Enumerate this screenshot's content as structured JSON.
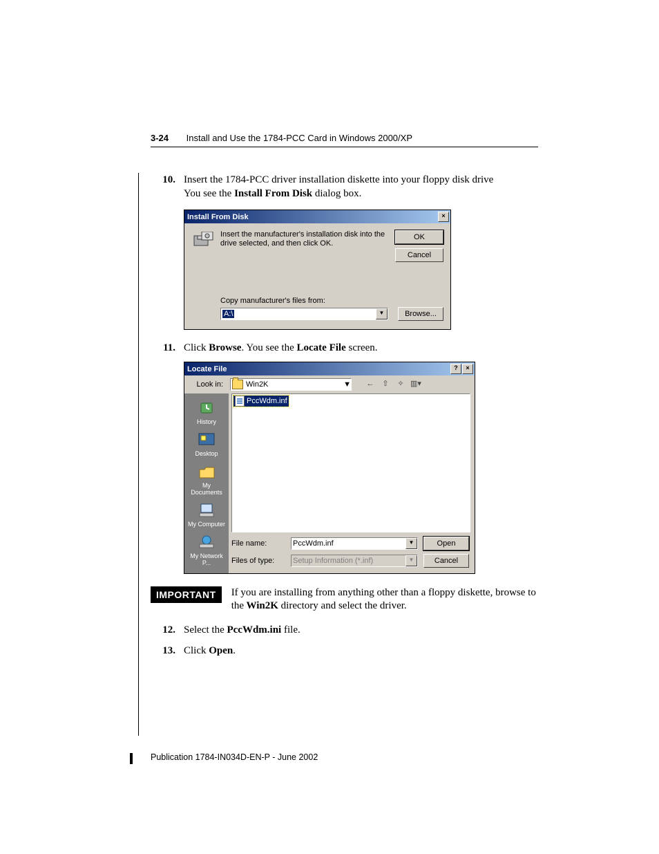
{
  "header": {
    "pagenum": "3-24",
    "title": "Install and Use the 1784-PCC Card in Windows 2000/XP"
  },
  "step10": {
    "num": "10.",
    "text_a": "Insert the 1784-PCC driver installation diskette into your floppy disk drive",
    "text_b_a": "You see the",
    "text_b_bold": " Install From Disk ",
    "text_b_b": "dialog box."
  },
  "dlg1": {
    "title": "Install From Disk",
    "close_glyph": "×",
    "msg": "Insert the manufacturer's installation disk into the drive selected, and then click OK.",
    "ok": "OK",
    "cancel": "Cancel",
    "copy_label": "Copy manufacturer's files from:",
    "path": "A:\\",
    "drop_glyph": "▼",
    "browse": "Browse..."
  },
  "step11": {
    "num": "11.",
    "a": "Click",
    "b": " Browse",
    "c": ". You see the",
    "d": " Locate File ",
    "e": "screen."
  },
  "dlg2": {
    "title": "Locate File",
    "help_glyph": "?",
    "close_glyph": "×",
    "lookin_label": "Look in:",
    "lookin_value": "Win2K",
    "drop_glyph": "▼",
    "back_glyph": "←",
    "up_glyph": "⇧",
    "new_glyph": "✧",
    "views_glyph": "▥▾",
    "places": {
      "history": "History",
      "desktop": "Desktop",
      "mydocs": "My Documents",
      "mycomp": "My Computer",
      "mynet": "My Network P..."
    },
    "file_selected": "PccWdm.inf",
    "fn_label": "File name:",
    "fn_value": "PccWdm.inf",
    "ft_label": "Files of type:",
    "ft_value": "Setup Information (*.inf)",
    "open": "Open",
    "cancel": "Cancel"
  },
  "important": {
    "tag": "IMPORTANT",
    "a": "If you are installing from anything other than a floppy diskette, browse to the",
    "b": " Win2K ",
    "c": "directory and select the driver."
  },
  "step12": {
    "num": "12.",
    "a": "Select the",
    "b": " PccWdm.ini ",
    "c": "file."
  },
  "step13": {
    "num": "13.",
    "a": "Click",
    "b": " Open",
    "c": "."
  },
  "footer": "Publication 1784-IN034D-EN-P - June 2002"
}
